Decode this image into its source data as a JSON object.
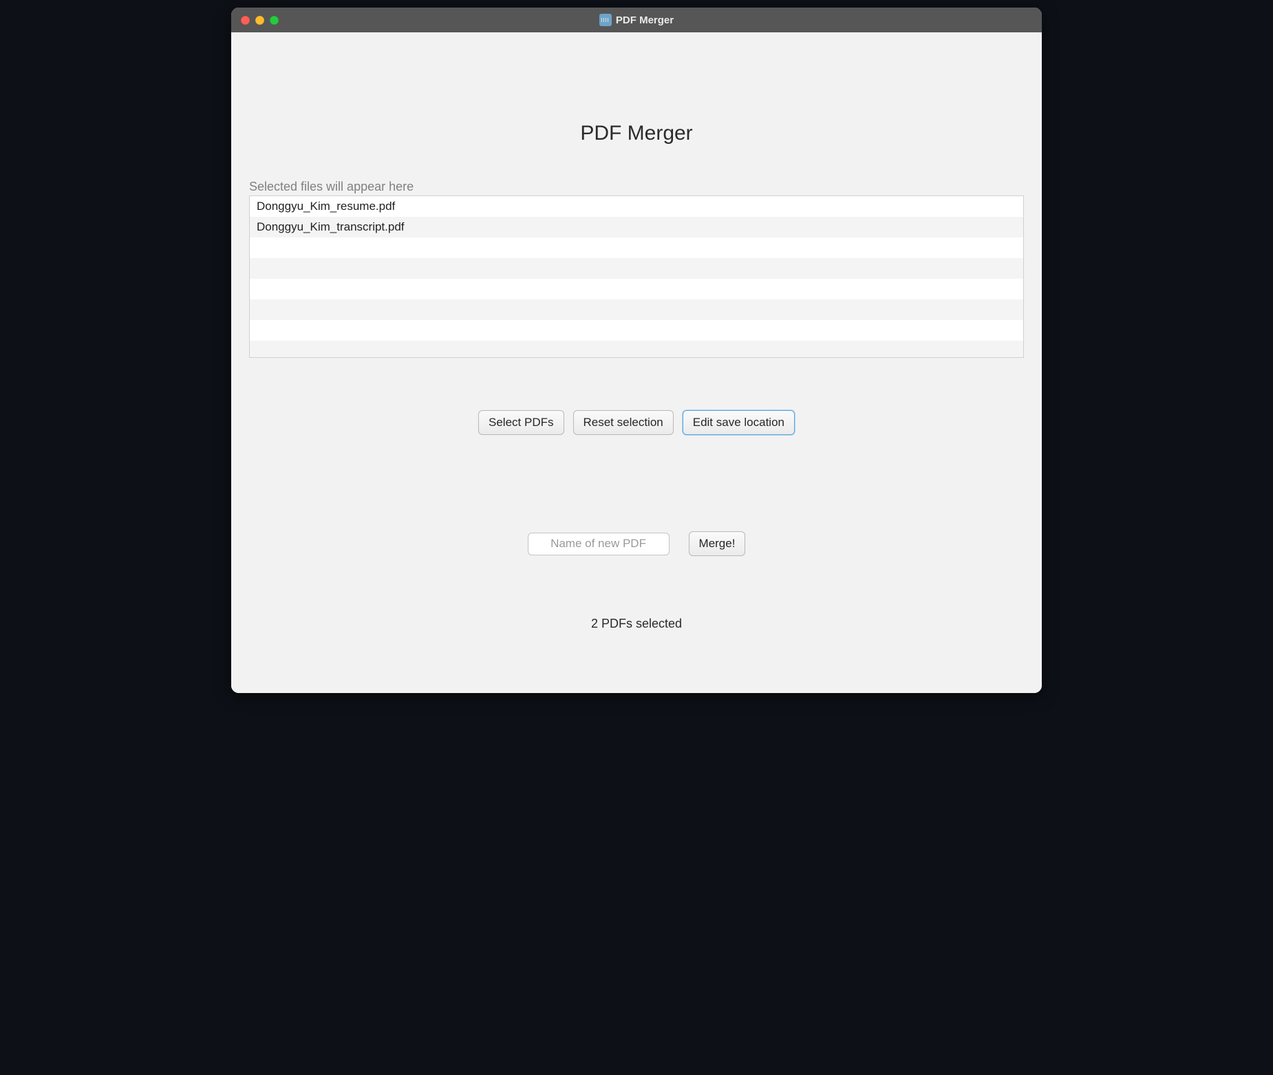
{
  "window": {
    "title": "PDF Merger"
  },
  "main": {
    "page_title": "PDF Merger",
    "list_label": "Selected files will appear here",
    "files": [
      "Donggyu_Kim_resume.pdf",
      "Donggyu_Kim_transcript.pdf",
      "",
      "",
      "",
      "",
      "",
      ""
    ],
    "buttons": {
      "select": "Select PDFs",
      "reset": "Reset selection",
      "edit_location": "Edit save location"
    },
    "merge": {
      "input_value": "",
      "input_placeholder": "Name of new PDF",
      "merge_label": "Merge!"
    },
    "status": "2 PDFs selected"
  }
}
